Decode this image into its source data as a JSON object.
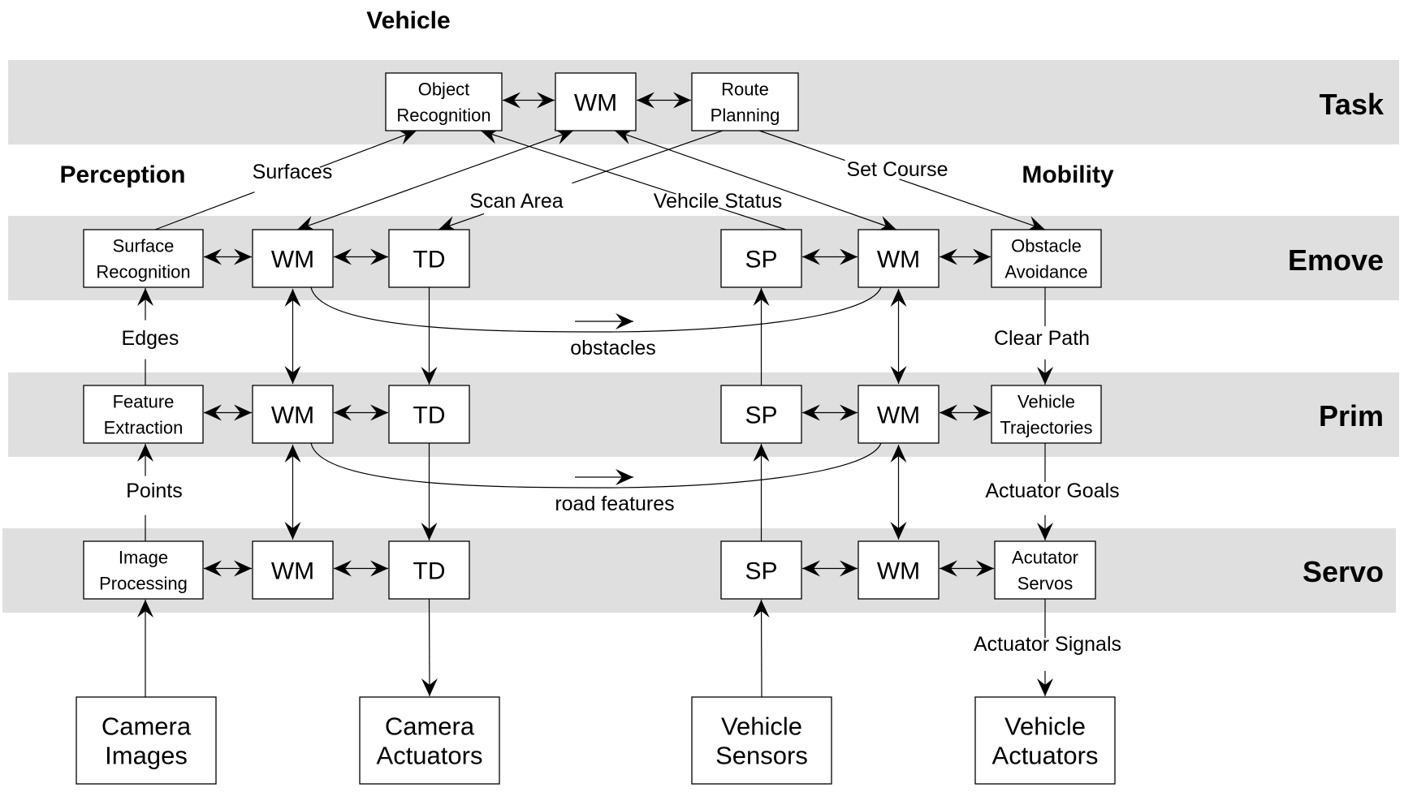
{
  "title": "Vehicle",
  "groups": {
    "perception": "Perception",
    "mobility": "Mobility"
  },
  "levels": [
    {
      "id": "task",
      "label": "Task"
    },
    {
      "id": "emove",
      "label": "Emove"
    },
    {
      "id": "prim",
      "label": "Prim"
    },
    {
      "id": "servo",
      "label": "Servo"
    }
  ],
  "nodes": {
    "object_recognition": [
      "Object",
      "Recognition"
    ],
    "task_wm": [
      "WM"
    ],
    "route_planning": [
      "Route",
      "Planning"
    ],
    "surface_recognition": [
      "Surface",
      "Recognition"
    ],
    "emove_wm_left": [
      "WM"
    ],
    "emove_td": [
      "TD"
    ],
    "emove_sp": [
      "SP"
    ],
    "emove_wm_right": [
      "WM"
    ],
    "obstacle_avoidance": [
      "Obstacle",
      "Avoidance"
    ],
    "feature_extraction": [
      "Feature",
      "Extraction"
    ],
    "prim_wm_left": [
      "WM"
    ],
    "prim_td": [
      "TD"
    ],
    "prim_sp": [
      "SP"
    ],
    "prim_wm_right": [
      "WM"
    ],
    "vehicle_trajectories": [
      "Vehicle",
      "Trajectories"
    ],
    "image_processing": [
      "Image",
      "Processing"
    ],
    "servo_wm_left": [
      "WM"
    ],
    "servo_td": [
      "TD"
    ],
    "servo_sp": [
      "SP"
    ],
    "servo_wm_right": [
      "WM"
    ],
    "actuator_servos": [
      "Acutator",
      "Servos"
    ],
    "camera_images": [
      "Camera",
      "Images"
    ],
    "camera_actuators": [
      "Camera",
      "Actuators"
    ],
    "vehicle_sensors": [
      "Vehicle",
      "Sensors"
    ],
    "vehicle_actuators": [
      "Vehicle",
      "Actuators"
    ]
  },
  "edge_labels": {
    "surfaces": "Surfaces",
    "scan_area": "Scan Area",
    "vehicle_status": "Vehcile Status",
    "set_course": "Set Course",
    "edges": "Edges",
    "points": "Points",
    "obstacles": "obstacles",
    "road_features": "road features",
    "clear_path": "Clear Path",
    "actuator_goals": "Actuator Goals",
    "actuator_signals": "Actuator Signals"
  }
}
